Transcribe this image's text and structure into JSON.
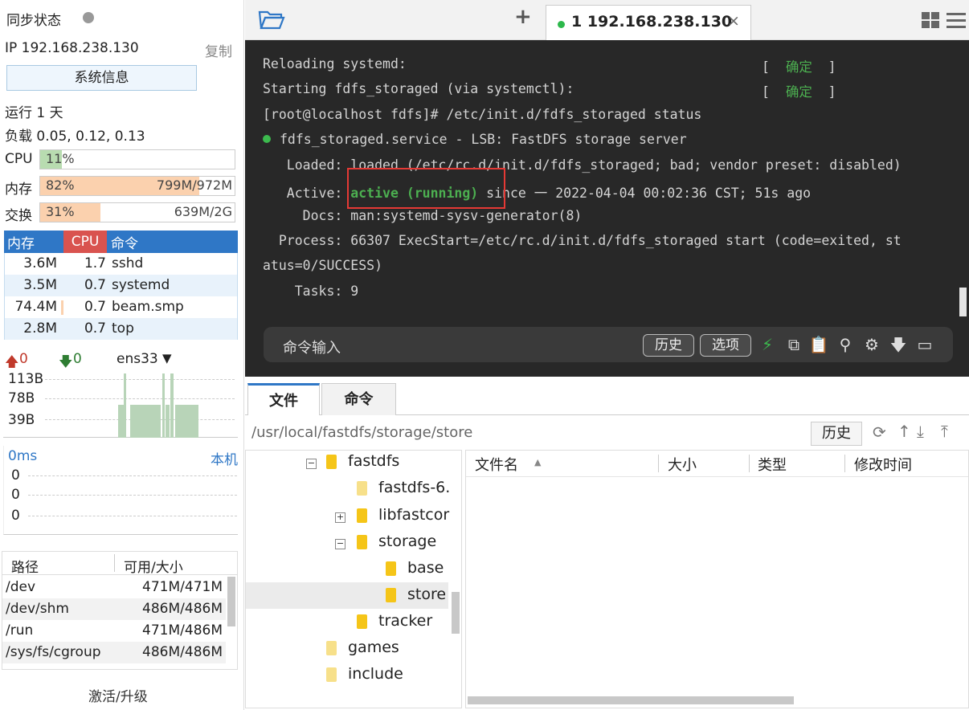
{
  "sync": {
    "label": "同步状态"
  },
  "ip": {
    "label": "IP 192.168.238.130",
    "copy": "复制"
  },
  "sysinfo_button": "系统信息",
  "uptime": "运行 1 天",
  "load": "负载 0.05, 0.12, 0.13",
  "cpu": {
    "label": "CPU",
    "percent": "11%",
    "value": 0.11
  },
  "mem": {
    "label": "内存",
    "percent": "82%",
    "detail": "799M/972M",
    "value": 0.82
  },
  "swap": {
    "label": "交换",
    "percent": "31%",
    "detail": "639M/2G",
    "value": 0.31
  },
  "process_table": {
    "headers": [
      "内存",
      "CPU",
      "命令"
    ],
    "rows": [
      {
        "mem": "3.6M",
        "cpu": "1.7",
        "cmd": "sshd"
      },
      {
        "mem": "3.5M",
        "cpu": "0.7",
        "cmd": "systemd"
      },
      {
        "mem": "74.4M",
        "cpu": "0.7",
        "cmd": "beam.smp"
      },
      {
        "mem": "2.8M",
        "cpu": "0.7",
        "cmd": "top"
      }
    ]
  },
  "network": {
    "up": "0",
    "down": "0",
    "interface": "ens33",
    "scale": [
      "113B",
      "78B",
      "39B"
    ]
  },
  "latency": {
    "label": "0ms",
    "host": "本机",
    "values": [
      "0",
      "0",
      "0"
    ]
  },
  "disk_table": {
    "headers": [
      "路径",
      "可用/大小"
    ],
    "rows": [
      {
        "path": "/dev",
        "size": "471M/471M"
      },
      {
        "path": "/dev/shm",
        "size": "486M/486M"
      },
      {
        "path": "/run",
        "size": "471M/486M"
      },
      {
        "path": "/sys/fs/cgroup",
        "size": "486M/486M"
      }
    ]
  },
  "activate": "激活/升级",
  "terminal_tab": {
    "label": "1 192.168.238.130"
  },
  "terminal": {
    "lines": [
      "Reloading systemd:",
      "Starting fdfs_storaged (via systemctl):",
      "[root@localhost fdfs]# /etc/init.d/fdfs_storaged status",
      "fdfs_storaged.service - LSB: FastDFS storage server",
      "   Loaded: loaded (/etc/rc.d/init.d/fdfs_storaged; bad; vendor preset: disabled)",
      "   Active: ",
      "     Docs: man:systemd-sysv-generator(8)",
      "  Process: 66307 ExecStart=/etc/rc.d/init.d/fdfs_storaged start (code=exited, st",
      "atus=0/SUCCESS)",
      "    Tasks: 9"
    ],
    "ok_label": "确定",
    "active_status": "active (running)",
    "active_rest": " since 一 2022-04-04 00:02:36 CST; 51s ago"
  },
  "command_bar": {
    "placeholder": "命令输入",
    "history": "历史",
    "options": "选项"
  },
  "file_tabs": [
    "文件",
    "命令"
  ],
  "path": {
    "value": "/usr/local/fastdfs/storage/store",
    "history": "历史"
  },
  "tree": [
    {
      "label": "fastdfs"
    },
    {
      "label": "fastdfs-6."
    },
    {
      "label": "libfastcor"
    },
    {
      "label": "storage"
    },
    {
      "label": "base"
    },
    {
      "label": "store"
    },
    {
      "label": "tracker"
    },
    {
      "label": "games"
    },
    {
      "label": "include"
    }
  ],
  "file_list": {
    "columns": [
      "文件名",
      "大小",
      "类型",
      "修改时间"
    ]
  }
}
